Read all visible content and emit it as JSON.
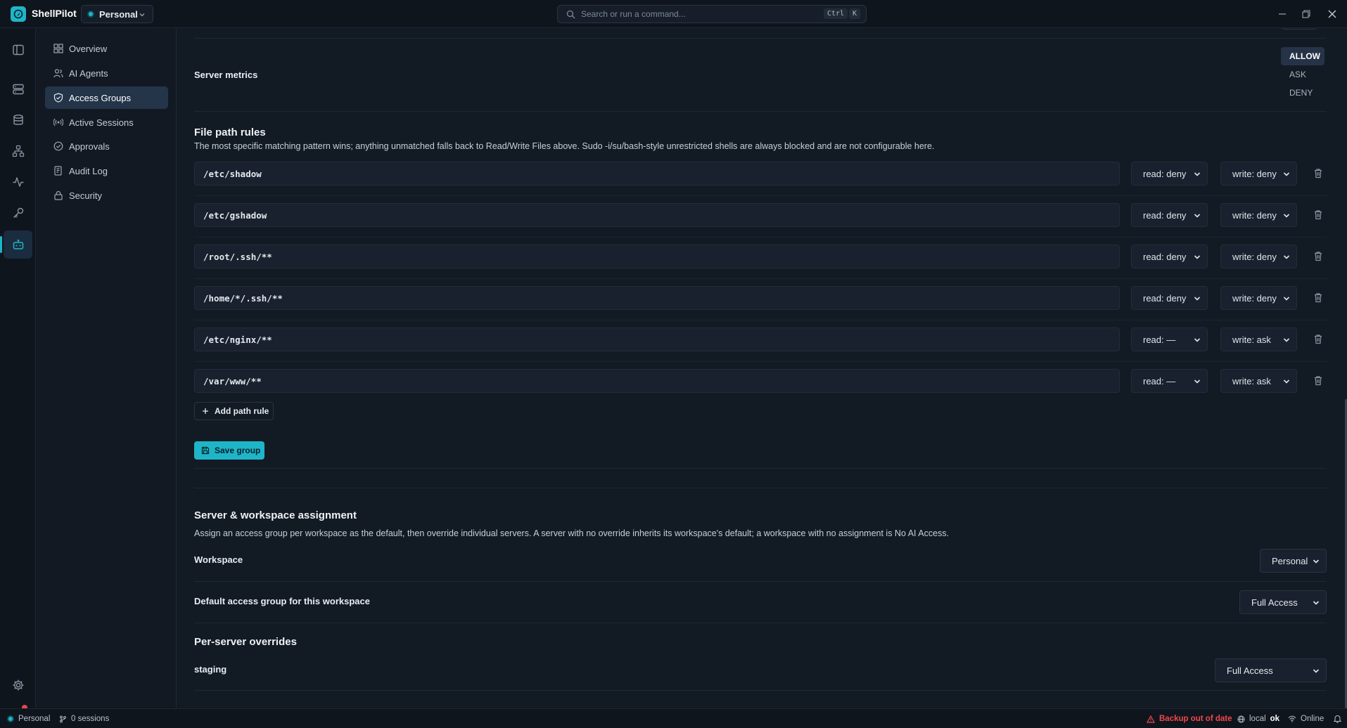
{
  "app": {
    "name": "ShellPilot",
    "workspace": "Personal"
  },
  "search": {
    "placeholder": "Search or run a command...",
    "shortcut_ctrl": "Ctrl",
    "shortcut_key": "K"
  },
  "sidebar": {
    "items": [
      {
        "label": "Overview",
        "icon": "grid-icon"
      },
      {
        "label": "AI Agents",
        "icon": "users-icon"
      },
      {
        "label": "Access Groups",
        "icon": "shield-icon",
        "active": true
      },
      {
        "label": "Active Sessions",
        "icon": "broadcast-icon"
      },
      {
        "label": "Approvals",
        "icon": "check-circle-icon"
      },
      {
        "label": "Audit Log",
        "icon": "log-icon"
      },
      {
        "label": "Security",
        "icon": "lock-icon"
      }
    ]
  },
  "server_metrics": {
    "label": "Server metrics",
    "options": [
      "ALLOW",
      "ASK",
      "DENY"
    ],
    "selected": "ALLOW"
  },
  "file_path_rules": {
    "title": "File path rules",
    "description": "The most specific matching pattern wins; anything unmatched falls back to Read/Write Files above. Sudo -i/su/bash-style unrestricted shells are always blocked and are not configurable here.",
    "rules": [
      {
        "path": "/etc/shadow",
        "read": "read: deny",
        "write": "write: deny"
      },
      {
        "path": "/etc/gshadow",
        "read": "read: deny",
        "write": "write: deny"
      },
      {
        "path": "/root/.ssh/**",
        "read": "read: deny",
        "write": "write: deny"
      },
      {
        "path": "/home/*/.ssh/**",
        "read": "read: deny",
        "write": "write: deny"
      },
      {
        "path": "/etc/nginx/**",
        "read": "read: —",
        "write": "write: ask"
      },
      {
        "path": "/var/www/**",
        "read": "read: —",
        "write": "write: ask"
      }
    ],
    "add_label": "Add path rule",
    "save_label": "Save group"
  },
  "assignment": {
    "title": "Server & workspace assignment",
    "description": "Assign an access group per workspace as the default, then override individual servers. A server with no override inherits its workspace's default; a workspace with no assignment is No AI Access.",
    "workspace_label": "Workspace",
    "workspace_value": "Personal",
    "default_label": "Default access group for this workspace",
    "default_value": "Full Access",
    "overrides_title": "Per-server overrides",
    "overrides": [
      {
        "server": "staging",
        "value": "Full Access"
      }
    ]
  },
  "statusbar": {
    "workspace": "Personal",
    "sessions": "0 sessions",
    "backup": "Backup out of date",
    "local_prefix": "local",
    "local_status": "ok",
    "network": "Online"
  },
  "colors": {
    "accent": "#1fb5c9",
    "warning": "#f0474c",
    "background": "#121a24"
  }
}
